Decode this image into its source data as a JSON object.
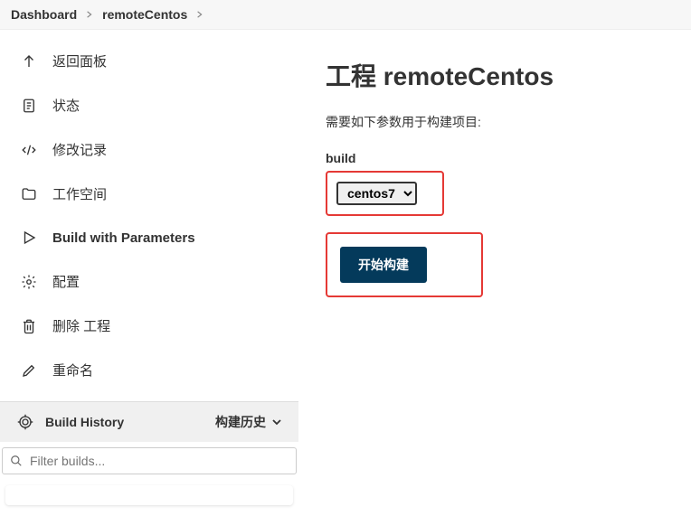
{
  "breadcrumb": {
    "items": [
      "Dashboard",
      "remoteCentos"
    ]
  },
  "sidebar": {
    "items": [
      {
        "label": "返回面板",
        "icon": "arrow-up",
        "bold": false
      },
      {
        "label": "状态",
        "icon": "document",
        "bold": false
      },
      {
        "label": "修改记录",
        "icon": "code",
        "bold": false
      },
      {
        "label": "工作空间",
        "icon": "folder",
        "bold": false
      },
      {
        "label": "Build with Parameters",
        "icon": "play",
        "bold": true
      },
      {
        "label": "配置",
        "icon": "gear",
        "bold": false
      },
      {
        "label": "删除 工程",
        "icon": "trash",
        "bold": false
      },
      {
        "label": "重命名",
        "icon": "pencil",
        "bold": false
      }
    ],
    "buildHistory": {
      "label": "Build History",
      "trend_label": "构建历史"
    },
    "filter": {
      "placeholder": "Filter builds..."
    }
  },
  "main": {
    "title_prefix": "工程 ",
    "title_name": "remoteCentos",
    "subtitle": "需要如下参数用于构建项目:",
    "param": {
      "label": "build",
      "selected": "centos7"
    },
    "build_button": "开始构建"
  }
}
